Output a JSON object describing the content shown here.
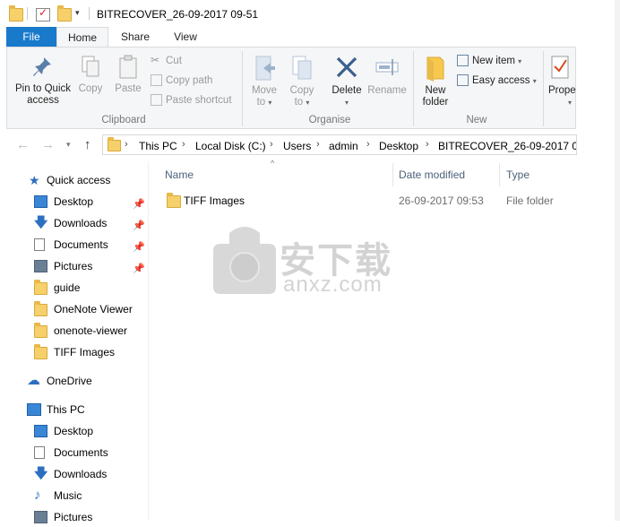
{
  "window": {
    "title": "BITRECOVER_26-09-2017 09-51"
  },
  "tabs": [
    "File",
    "Home",
    "Share",
    "View"
  ],
  "ribbon": {
    "clipboard": {
      "pin_label_1": "Pin to Quick",
      "pin_label_2": "access",
      "copy": "Copy",
      "paste": "Paste",
      "cut": "Cut",
      "copy_path": "Copy path",
      "paste_shortcut": "Paste shortcut",
      "group": "Clipboard"
    },
    "organise": {
      "move_1": "Move",
      "move_2": "to",
      "copy_1": "Copy",
      "copy_2": "to",
      "delete": "Delete",
      "rename": "Rename",
      "group": "Organise"
    },
    "new": {
      "new_folder_1": "New",
      "new_folder_2": "folder",
      "new_item": "New item",
      "easy_access": "Easy access",
      "group": "New"
    },
    "open": {
      "properties": "Prope"
    }
  },
  "address": {
    "crumbs": [
      "This PC",
      "Local Disk (C:)",
      "Users",
      "admin",
      "Desktop",
      "BITRECOVER_26-09-2017 09-5"
    ]
  },
  "nav_pane": {
    "quick_access": "Quick access",
    "quick_items": [
      "Desktop",
      "Downloads",
      "Documents",
      "Pictures",
      "guide",
      "OneNote Viewer",
      "onenote-viewer",
      "TIFF Images"
    ],
    "onedrive": "OneDrive",
    "this_pc": "This PC",
    "pc_items": [
      "Desktop",
      "Documents",
      "Downloads",
      "Music",
      "Pictures"
    ]
  },
  "columns": {
    "name": "Name",
    "date": "Date modified",
    "type": "Type"
  },
  "files": [
    {
      "name": "TIFF Images",
      "date": "26-09-2017 09:53",
      "type": "File folder"
    }
  ],
  "watermark": {
    "text_cn": "安下载",
    "text_en": "anxz.com"
  }
}
